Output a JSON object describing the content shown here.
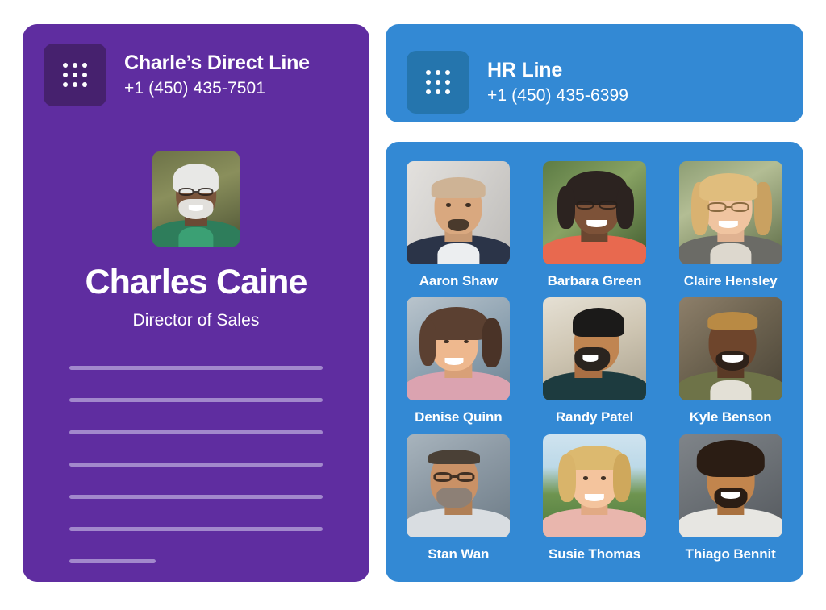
{
  "direct_line": {
    "icon": "dialpad-icon",
    "title": "Charle’s Direct Line",
    "number": "+1 (450) 435-7501",
    "card_color": "#5F2DA0",
    "icon_tile_color": "#46216E"
  },
  "profile": {
    "name": "Charles Caine",
    "role": "Director of Sales",
    "avatar_alt": "charles-caine-avatar"
  },
  "placeholder_lines": [
    {
      "width": "full"
    },
    {
      "width": "full"
    },
    {
      "width": "full"
    },
    {
      "width": "full"
    },
    {
      "width": "full"
    },
    {
      "width": "full"
    },
    {
      "width": "short"
    }
  ],
  "hr_line": {
    "icon": "dialpad-icon",
    "title": "HR Line",
    "number": "+1 (450) 435-6399",
    "card_color": "#3389D4",
    "icon_tile_color": "#2575AD"
  },
  "contacts_panel": {
    "background": "#3389D4",
    "contacts": [
      {
        "name": "Aaron Shaw",
        "avatar_alt": "aaron-shaw-avatar"
      },
      {
        "name": "Barbara Green",
        "avatar_alt": "barbara-green-avatar"
      },
      {
        "name": "Claire Hensley",
        "avatar_alt": "claire-hensley-avatar"
      },
      {
        "name": "Denise Quinn",
        "avatar_alt": "denise-quinn-avatar"
      },
      {
        "name": "Randy Patel",
        "avatar_alt": "randy-patel-avatar"
      },
      {
        "name": "Kyle Benson",
        "avatar_alt": "kyle-benson-avatar"
      },
      {
        "name": "Stan Wan",
        "avatar_alt": "stan-wan-avatar"
      },
      {
        "name": "Susie Thomas",
        "avatar_alt": "susie-thomas-avatar"
      },
      {
        "name": "Thiago Bennit",
        "avatar_alt": "thiago-bennit-avatar"
      }
    ]
  }
}
